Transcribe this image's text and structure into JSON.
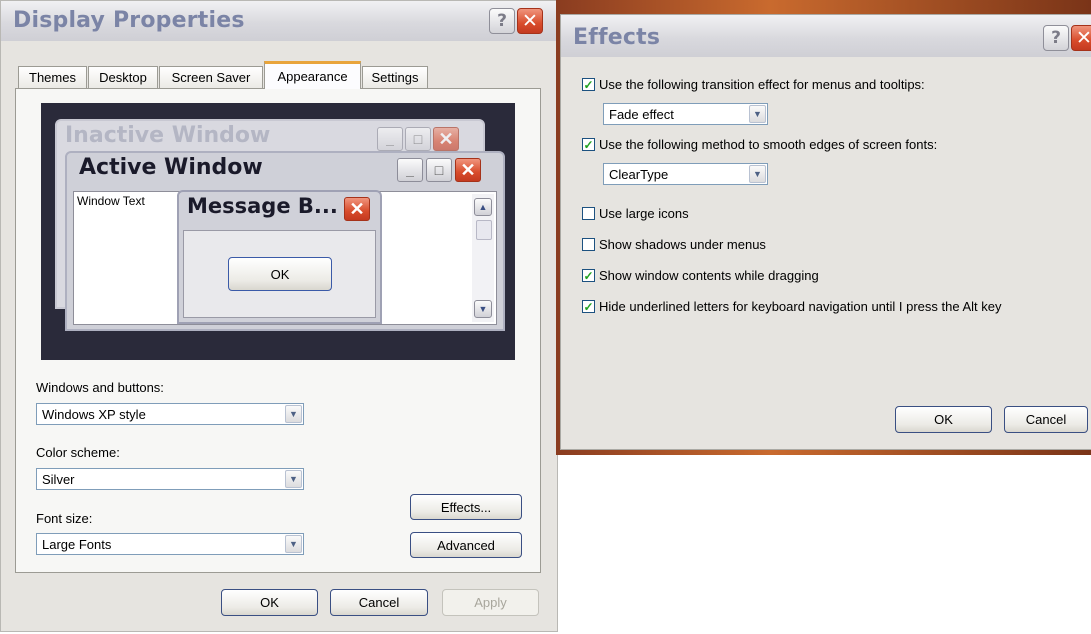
{
  "display_properties": {
    "title": "Display Properties",
    "help_glyph": "?",
    "close_glyph": "✕",
    "tabs": [
      {
        "label": "Themes"
      },
      {
        "label": "Desktop"
      },
      {
        "label": "Screen Saver"
      },
      {
        "label": "Appearance",
        "active": true
      },
      {
        "label": "Settings"
      }
    ],
    "preview": {
      "inactive_title": "Inactive Window",
      "active_title": "Active Window",
      "window_text": "Window Text",
      "message_title": "Message B...",
      "message_ok": "OK",
      "minimize_glyph": "_",
      "maximize_glyph": "□",
      "close_glyph": "✕",
      "scroll_up_glyph": "▲",
      "scroll_down_glyph": "▼"
    },
    "windows_buttons": {
      "label": "Windows and buttons:",
      "value": "Windows XP style"
    },
    "color_scheme": {
      "label": "Color scheme:",
      "value": "Silver"
    },
    "font_size": {
      "label": "Font size:",
      "value": "Large Fonts"
    },
    "effects_button": "Effects...",
    "advanced_button": "Advanced",
    "ok_button": "OK",
    "cancel_button": "Cancel",
    "apply_button": "Apply",
    "dropdown_glyph": "▼"
  },
  "effects": {
    "title": "Effects",
    "help_glyph": "?",
    "close_glyph": "✕",
    "check_glyph": "✓",
    "options": [
      {
        "label": "Use the following transition effect for menus and tooltips:",
        "checked": true
      },
      {
        "label": "Use the following method to smooth edges of screen fonts:",
        "checked": true
      },
      {
        "label": "Use large icons",
        "checked": false
      },
      {
        "label": "Show shadows under menus",
        "checked": false
      },
      {
        "label": "Show window contents while dragging",
        "checked": true
      },
      {
        "label": "Hide underlined letters for keyboard navigation until I press the Alt key",
        "checked": true
      }
    ],
    "transition_effect": "Fade effect",
    "smoothing_method": "ClearType",
    "ok_button": "OK",
    "cancel_button": "Cancel"
  },
  "colors": {
    "title_text": "#7b84a6",
    "active_tab_accent": "#e8a43b",
    "close_red": "#d84c2c",
    "check_green": "#21a121",
    "preview_background": "#2a2a3a"
  }
}
